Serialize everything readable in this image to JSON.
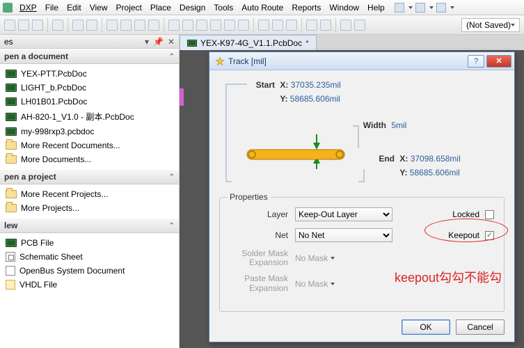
{
  "menu": {
    "dxp": "DXP",
    "items": [
      "File",
      "Edit",
      "View",
      "Project",
      "Place",
      "Design",
      "Tools",
      "Auto Route",
      "Reports",
      "Window",
      "Help"
    ]
  },
  "toolbar": {
    "not_saved": "(Not Saved)"
  },
  "left": {
    "tab_label": "es",
    "sec_open_doc": "pen a document",
    "docs": [
      "YEX-PTT.PcbDoc",
      "LIGHT_b.PcbDoc",
      "LH01B01.PcbDoc",
      "AH-820-1_V1.0 - 副本.PcbDoc",
      "my-998rxp3.pcbdoc"
    ],
    "more_recent_docs": "More Recent Documents...",
    "more_docs": "More Documents...",
    "sec_open_proj": "pen a project",
    "more_recent_proj": "More Recent Projects...",
    "more_proj": "More Projects...",
    "sec_new": "lew",
    "new_items": [
      "PCB File",
      "Schematic Sheet",
      "OpenBus System Document",
      "VHDL File"
    ]
  },
  "doctab": {
    "name": "YEX-K97-4G_V1.1.PcbDoc",
    "dirty": "*"
  },
  "dialog": {
    "title": "Track [mil]",
    "start_label": "Start",
    "end_label": "End",
    "width_label": "Width",
    "x": "X:",
    "y": "Y:",
    "start_x": "37035.235mil",
    "start_y": "58685.606mil",
    "end_x": "37098.658mil",
    "end_y": "58685.606mil",
    "width_val": "5mil",
    "properties": "Properties",
    "layer_label": "Layer",
    "layer_value": "Keep-Out Layer",
    "net_label": "Net",
    "net_value": "No Net",
    "solder_label": "Solder Mask Expansion",
    "paste_label": "Paste Mask Expansion",
    "nomask": "No Mask",
    "locked_label": "Locked",
    "keepout_label": "Keepout",
    "ok": "OK",
    "cancel": "Cancel"
  },
  "annotation": "keepout勾勾不能勾"
}
